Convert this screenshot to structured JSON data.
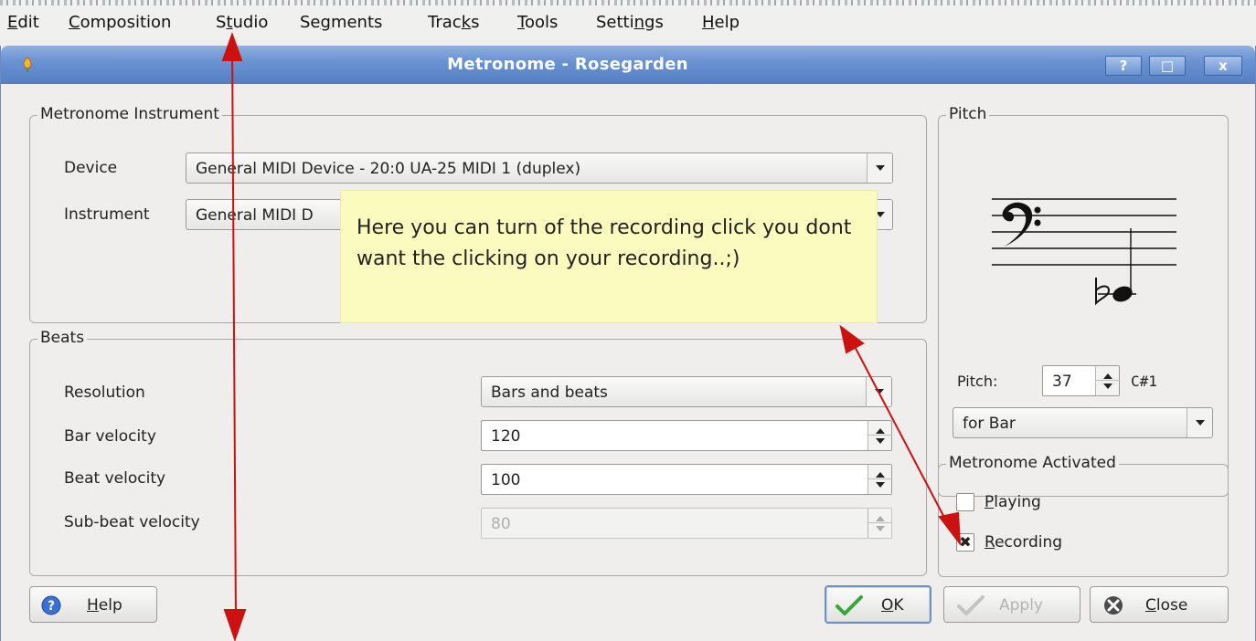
{
  "menubar": {
    "items": [
      {
        "label": "Edit",
        "mnemonic": "E",
        "rest": "dit"
      },
      {
        "label": "Composition",
        "mnemonic": "C",
        "rest": "omposition"
      },
      {
        "label": "Studio",
        "pre": "S",
        "mnemonic": "t",
        "rest": "udio"
      },
      {
        "label": "Segments",
        "pre": "Se",
        "mnemonic": "g",
        "rest": "ments"
      },
      {
        "label": "Tracks",
        "pre": "Trac",
        "mnemonic": "k",
        "rest": "s"
      },
      {
        "label": "Tools",
        "mnemonic": "T",
        "rest": "ools"
      },
      {
        "label": "Settings",
        "pre": "Setti",
        "mnemonic": "n",
        "rest": "gs"
      },
      {
        "label": "Help",
        "mnemonic": "H",
        "rest": "elp"
      }
    ]
  },
  "window": {
    "title": "Metronome - Rosegarden",
    "buttons": {
      "help": "?",
      "maximize": "□",
      "close": "x"
    },
    "accent": "#6a93d3"
  },
  "instrument_group": {
    "title": "Metronome Instrument",
    "device_label": "Device",
    "device_value": "General MIDI Device - 20:0 UA-25 MIDI 1 (duplex)",
    "instrument_label": "Instrument",
    "instrument_value": "General MIDI D"
  },
  "beats_group": {
    "title": "Beats",
    "resolution_label": "Resolution",
    "resolution_value": "Bars and beats",
    "bar_velocity_label": "Bar velocity",
    "bar_velocity_value": "120",
    "beat_velocity_label": "Beat velocity",
    "beat_velocity_value": "100",
    "subbeat_velocity_label": "Sub-beat velocity",
    "subbeat_velocity_value": "80"
  },
  "pitch_group": {
    "title": "Pitch",
    "pitch_label": "Pitch:",
    "pitch_value": "37",
    "pitch_note": "C#1",
    "for_value": "for Bar"
  },
  "activated_group": {
    "title": "Metronome Activated",
    "playing": {
      "mnemonic": "P",
      "rest": "laying",
      "checked": false
    },
    "recording": {
      "mnemonic": "R",
      "rest": "ecording",
      "checked": true,
      "mark": "✖"
    }
  },
  "footer": {
    "help": {
      "mnemonic": "H",
      "rest": "elp"
    },
    "ok": {
      "mnemonic": "O",
      "rest": "K"
    },
    "apply": {
      "label": "Apply"
    },
    "close": {
      "mnemonic": "C",
      "rest": "lose"
    }
  },
  "annotation": {
    "text": "Here you can turn of the recording click you dont want the clicking on your recording..;)",
    "arrow_color": "#cc1111"
  }
}
